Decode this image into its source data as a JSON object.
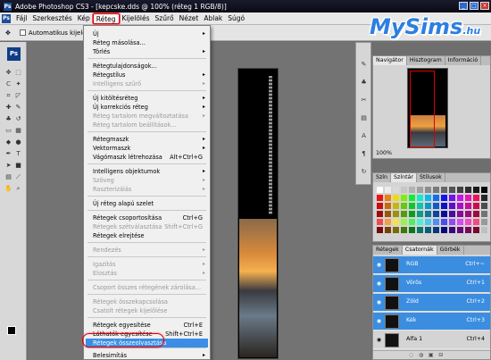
{
  "window": {
    "title": "Adobe Photoshop CS3 - [kepcske.dds @ 100% (réteg 1 RGB/8)]",
    "app_icon": "Ps"
  },
  "menubar": {
    "items": [
      "Fájl",
      "Szerkesztés",
      "Kép",
      "Réteg",
      "Kijelölés",
      "Szűrő",
      "Nézet",
      "Ablak",
      "Súgó"
    ],
    "active": "Réteg"
  },
  "options_bar": {
    "auto_select_label": "Automatikus kijelö"
  },
  "logo": {
    "text": "MySims",
    "suffix": ".hu"
  },
  "layer_menu": {
    "items": [
      {
        "label": "Új",
        "submenu": true,
        "disabled": false
      },
      {
        "label": "Réteg másolása...",
        "disabled": false
      },
      {
        "label": "Törlés",
        "submenu": true,
        "disabled": false
      },
      {
        "label": "Rétegtulajdonságok...",
        "disabled": false
      },
      {
        "label": "Rétegstílus",
        "submenu": true,
        "disabled": false
      },
      {
        "label": "Intelligens szűrő",
        "submenu": true,
        "disabled": true
      },
      {
        "label": "Új kitöltésréteg",
        "submenu": true,
        "disabled": false
      },
      {
        "label": "Új korrekciós réteg",
        "submenu": true,
        "disabled": false
      },
      {
        "label": "Réteg tartalom megváltoztatása",
        "submenu": true,
        "disabled": true
      },
      {
        "label": "Réteg tartalom beállítások...",
        "disabled": true
      },
      {
        "label": "Rétegmaszk",
        "submenu": true,
        "disabled": false
      },
      {
        "label": "Vektormaszk",
        "submenu": true,
        "disabled": false
      },
      {
        "label": "Vágómaszk létrehozása",
        "shortcut": "Alt+Ctrl+G",
        "disabled": false
      },
      {
        "label": "Intelligens objektumok",
        "submenu": true,
        "disabled": false
      },
      {
        "label": "Szöveg",
        "submenu": true,
        "disabled": true
      },
      {
        "label": "Raszterizálás",
        "submenu": true,
        "disabled": true
      },
      {
        "label": "Új réteg alapú szelet",
        "disabled": false
      },
      {
        "label": "Rétegek csoportosítása",
        "shortcut": "Ctrl+G",
        "disabled": false
      },
      {
        "label": "Rétegek szétválasztása",
        "shortcut": "Shift+Ctrl+G",
        "disabled": true
      },
      {
        "label": "Rétegek elrejtése",
        "disabled": false
      },
      {
        "label": "Rendezés",
        "submenu": true,
        "disabled": true
      },
      {
        "label": "Igazítás",
        "submenu": true,
        "disabled": true
      },
      {
        "label": "Elosztás",
        "submenu": true,
        "disabled": true
      },
      {
        "label": "Csoport összes rétegének zárolása...",
        "disabled": true
      },
      {
        "label": "Rétegek összekapcsolása",
        "disabled": true
      },
      {
        "label": "Csatolt rétegek kijelölése",
        "disabled": true
      },
      {
        "label": "Rétegek egyesítése",
        "shortcut": "Ctrl+E",
        "disabled": false
      },
      {
        "label": "Láthatók egyesítése",
        "shortcut": "Shift+Ctrl+E",
        "disabled": false
      },
      {
        "label": "Rétegek összeolvasztása",
        "disabled": false,
        "highlighted": true
      },
      {
        "label": "Belesimítás",
        "submenu": true,
        "disabled": false
      }
    ]
  },
  "navigator_panel": {
    "tabs": [
      "Navigátor",
      "Hisztogram",
      "Információ"
    ],
    "zoom": "100%"
  },
  "swatches_panel": {
    "tabs": [
      "Szín",
      "Színtár",
      "Stílusok"
    ],
    "active_tab": "Színtár"
  },
  "layers_panel": {
    "tabs": [
      "Rétegek",
      "Csatornák",
      "Görbék"
    ],
    "active_tab": "Csatornák",
    "channels": [
      {
        "name": "RGB",
        "shortcut": "Ctrl+~",
        "selected": true
      },
      {
        "name": "Vörös",
        "shortcut": "Ctrl+1",
        "selected": true
      },
      {
        "name": "Zöld",
        "shortcut": "Ctrl+2",
        "selected": true
      },
      {
        "name": "Kék",
        "shortcut": "Ctrl+3",
        "selected": true
      },
      {
        "name": "Alfa 1",
        "shortcut": "Ctrl+4",
        "selected": false
      }
    ]
  },
  "colors": {
    "accent": "#3a8ee6",
    "highlight_ring": "#d4000f",
    "selected_row": "#3b8de0"
  }
}
